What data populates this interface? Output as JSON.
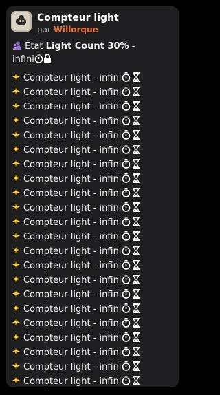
{
  "header": {
    "title": "Compteur light",
    "by_label": "par",
    "author": "Willorque"
  },
  "status": {
    "prefix": "État",
    "name": "Light Count 30%",
    "separator": "-",
    "duration": "infini",
    "icons": [
      "people-icon",
      "timer-icon",
      "lock-icon"
    ]
  },
  "effects": [
    {
      "label": "Compteur light - infini"
    },
    {
      "label": "Compteur light - infini"
    },
    {
      "label": "Compteur light - infini"
    },
    {
      "label": "Compteur light - infini"
    },
    {
      "label": "Compteur light - infini"
    },
    {
      "label": "Compteur light - infini"
    },
    {
      "label": "Compteur light - infini"
    },
    {
      "label": "Compteur light - infini"
    },
    {
      "label": "Compteur light - infini"
    },
    {
      "label": "Compteur light - infini"
    },
    {
      "label": "Compteur light - infini"
    },
    {
      "label": "Compteur light - infini"
    },
    {
      "label": "Compteur light - infini"
    },
    {
      "label": "Compteur light - infini"
    },
    {
      "label": "Compteur light - infini"
    },
    {
      "label": "Compteur light - infini"
    },
    {
      "label": "Compteur light - infini"
    },
    {
      "label": "Compteur light - infini"
    },
    {
      "label": "Compteur light - infini"
    },
    {
      "label": "Compteur light - infini"
    },
    {
      "label": "Compteur light - infini"
    },
    {
      "label": "Compteur light - infini"
    }
  ],
  "effect_icons": [
    "sparkle-icon",
    "timer-icon",
    "hourglass-icon"
  ],
  "colors": {
    "card_bg": "#1f1f21",
    "author": "#e8703a",
    "sparkle": "#f6c94a",
    "people": "#9a6bd8"
  }
}
